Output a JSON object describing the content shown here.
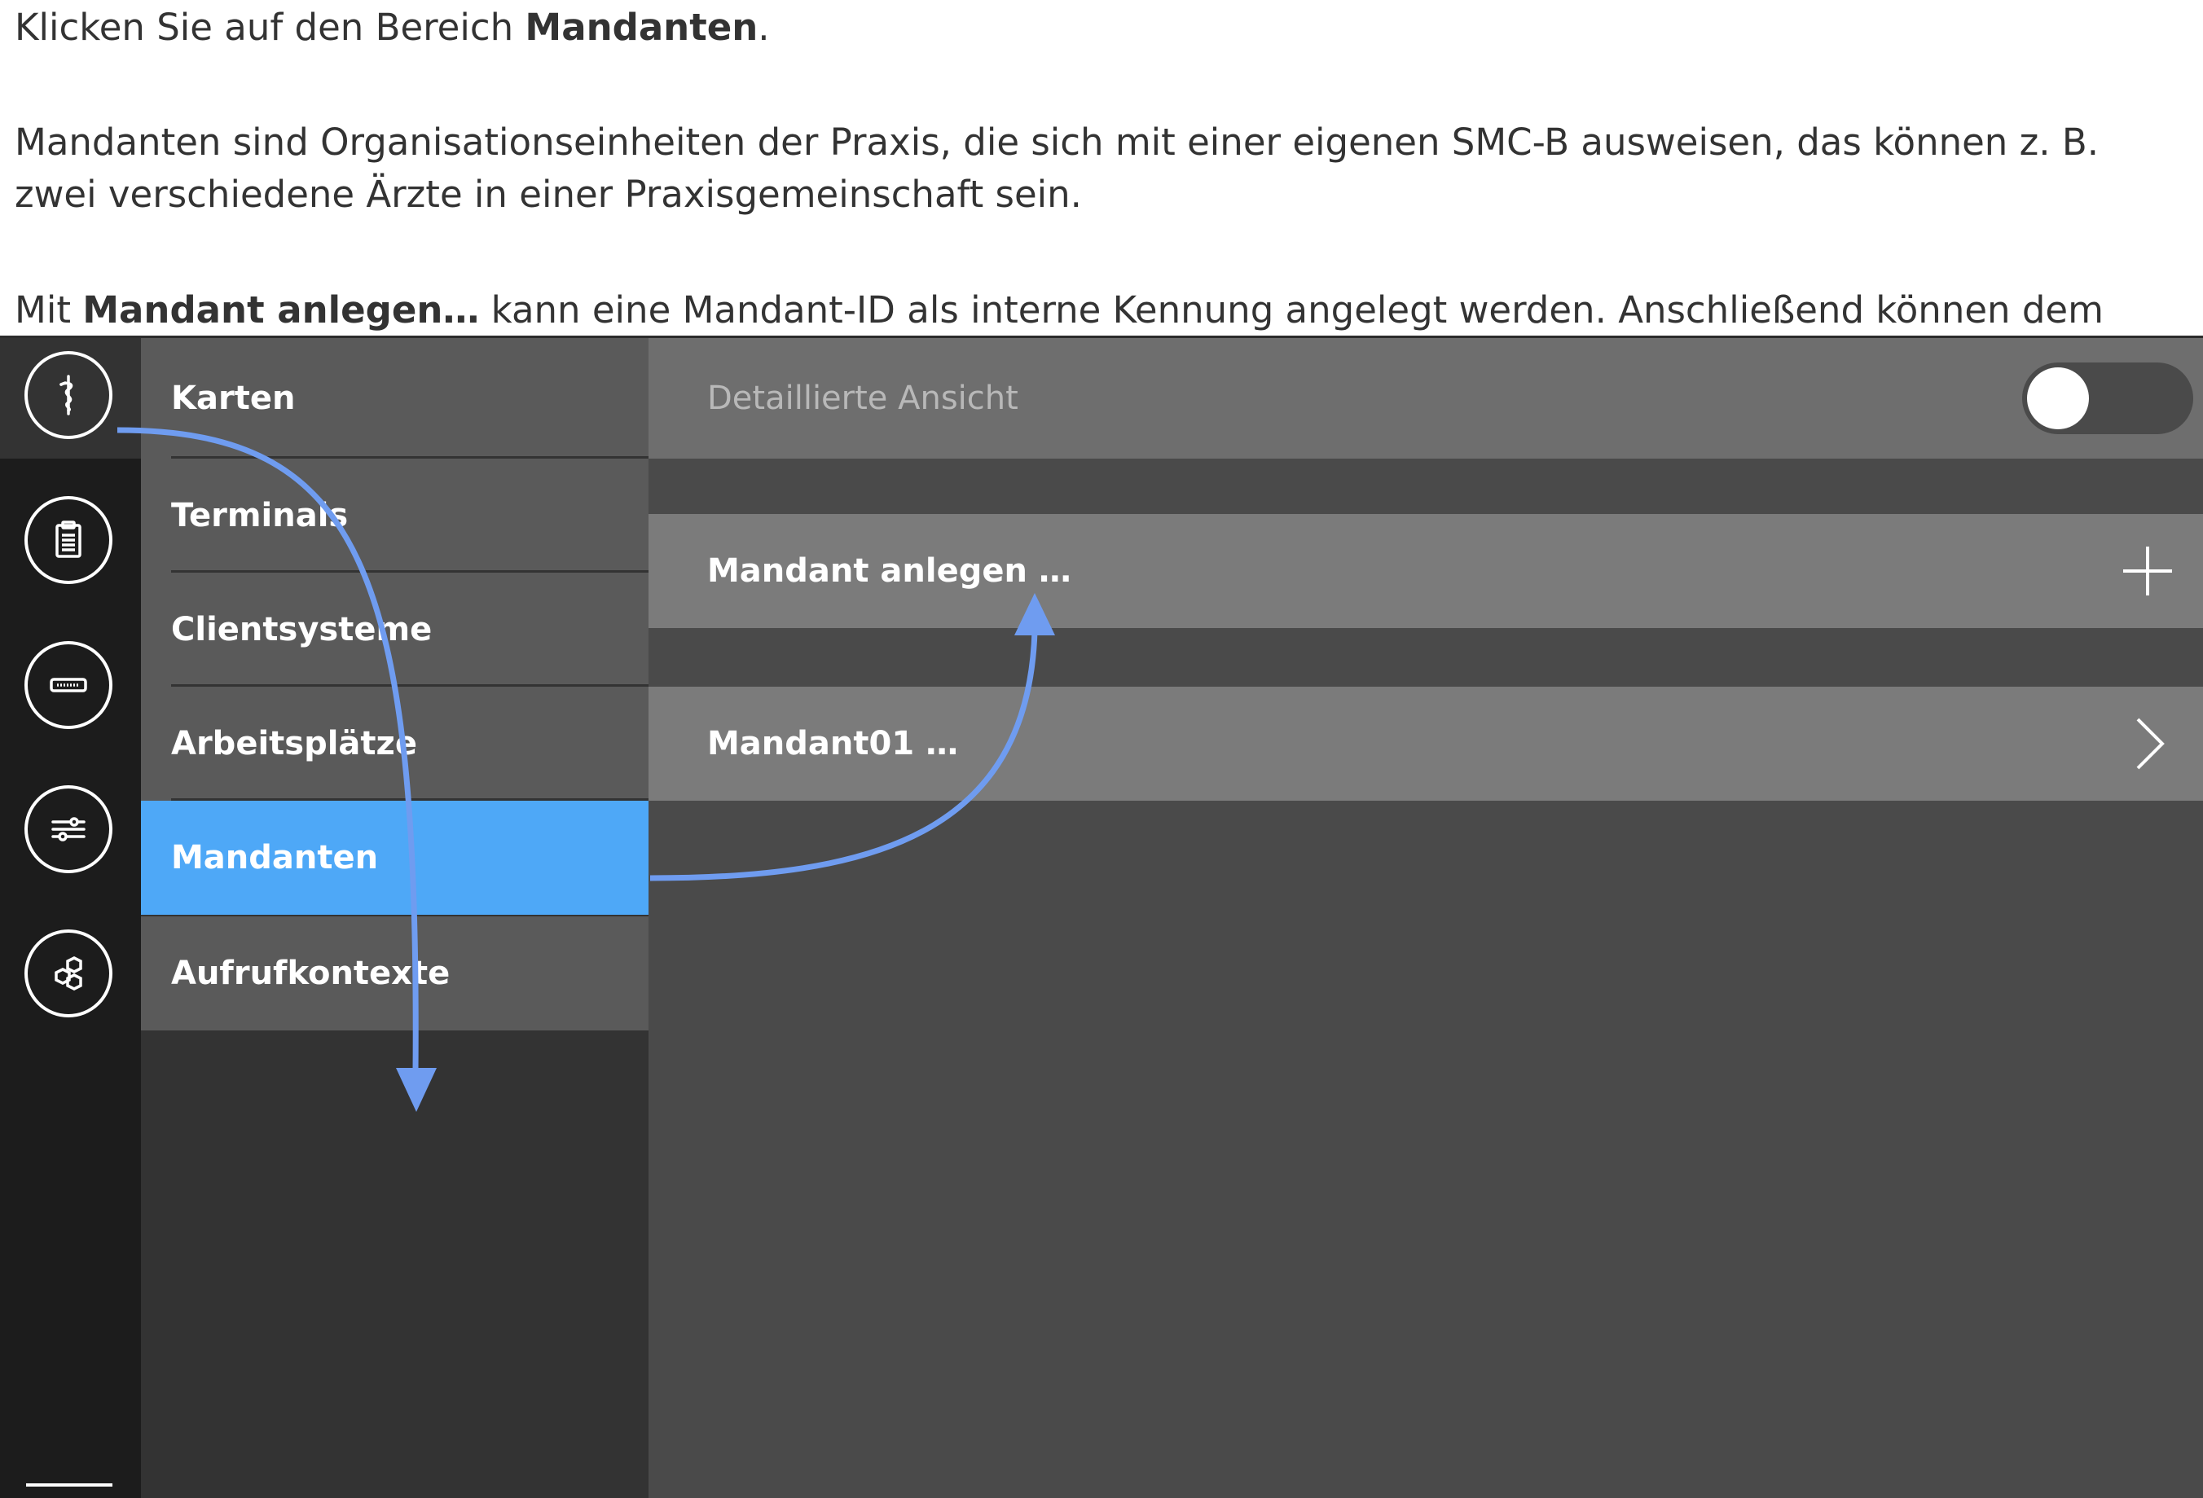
{
  "doc": {
    "p1_prefix": "Klicken Sie auf den Bereich ",
    "p1_bold": "Mandanten",
    "p1_suffix": ".",
    "p2_line1": "Mandanten sind Organisationseinheiten der Praxis, die sich mit einer eigenen SMC-B ausweisen, das können z. B.",
    "p2_line2": "zwei verschiedene Ärzte in einer Praxisgemeinschaft sein.",
    "p3_prefix": "Mit ",
    "p3_bold": "Mandant anlegen…",
    "p3_suffix": " kann eine Mandant-ID als interne Kennung angelegt werden. Anschließend können dem"
  },
  "iconbar": {
    "items": [
      {
        "icon": "caduceus-icon",
        "active": true
      },
      {
        "icon": "clipboard-icon",
        "active": false
      },
      {
        "icon": "card-reader-icon",
        "active": false
      },
      {
        "icon": "sliders-icon",
        "active": false
      },
      {
        "icon": "hexagons-icon",
        "active": false
      }
    ]
  },
  "subnav": {
    "items": [
      {
        "label": "Karten"
      },
      {
        "label": "Terminals"
      },
      {
        "label": "Clientsysteme"
      },
      {
        "label": "Arbeitsplätze"
      },
      {
        "label": "Mandanten",
        "active": true
      },
      {
        "label": "Aufrufkontexte"
      }
    ]
  },
  "detail": {
    "header_label": "Detaillierte Ansicht",
    "toggle_on": false,
    "create_label": "Mandant anlegen …",
    "create_icon": "plus-icon",
    "mandant_label": "Mandant01 …",
    "mandant_icon": "chevron-right-icon"
  },
  "colors": {
    "accent": "#4ea8f7",
    "arrow": "#6f9cf0",
    "iconbar_bg": "#1c1c1c",
    "nav_item_bg": "#5a5a5a",
    "row_bg": "#7b7b7b",
    "panel_bg": "#4a4a4a"
  }
}
